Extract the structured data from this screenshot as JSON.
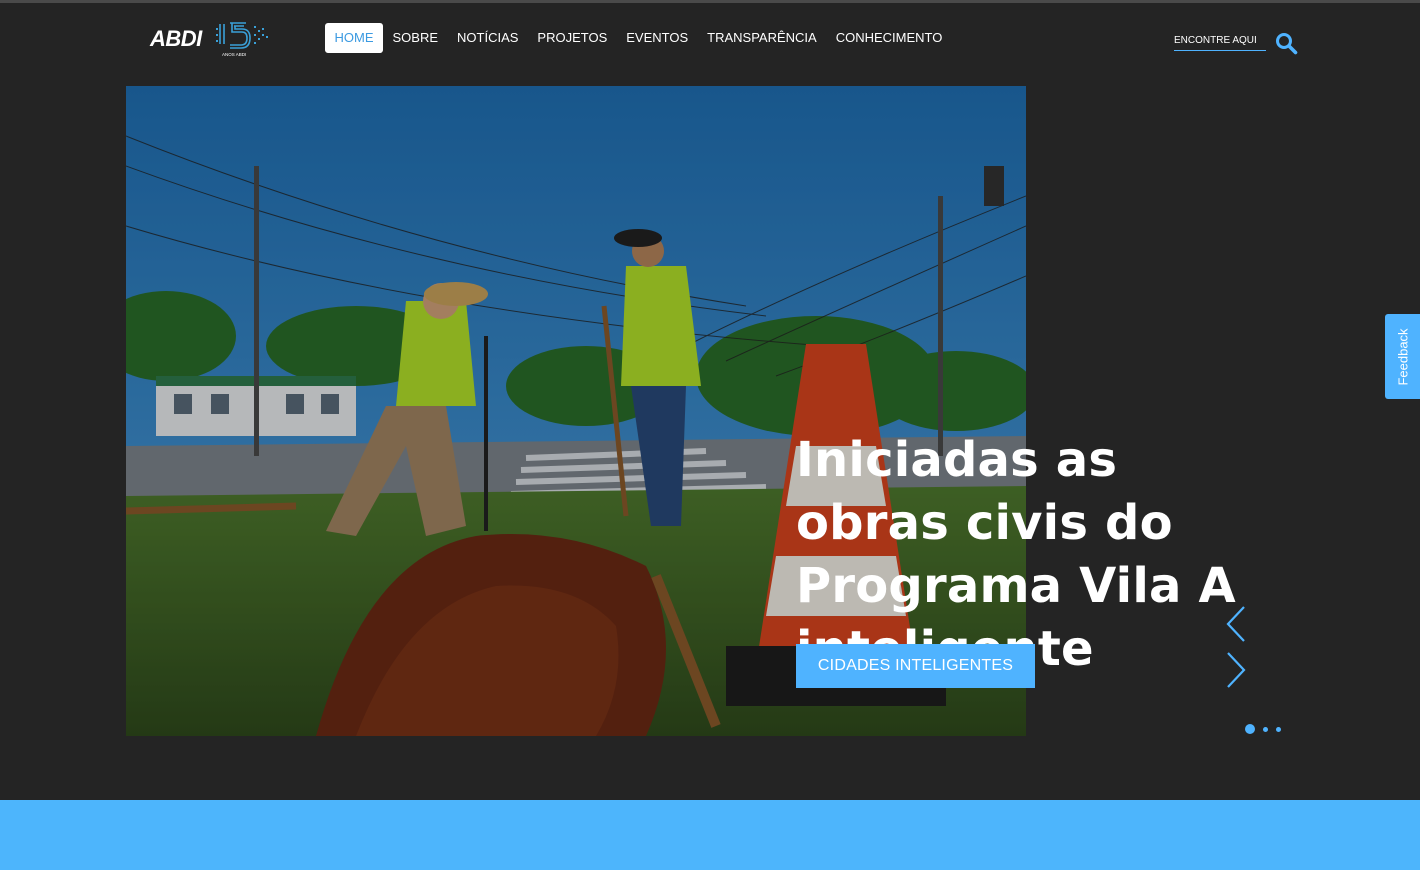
{
  "header": {
    "logo_text": "ABDI",
    "logo_badge": "15",
    "logo_badge_caption": "ANOS ABDI",
    "nav": [
      {
        "label": "HOME",
        "active": true
      },
      {
        "label": "SOBRE",
        "active": false
      },
      {
        "label": "NOTÍCIAS",
        "active": false
      },
      {
        "label": "PROJETOS",
        "active": false
      },
      {
        "label": "EVENTOS",
        "active": false
      },
      {
        "label": "TRANSPARÊNCIA",
        "active": false
      },
      {
        "label": "CONHECIMENTO",
        "active": false
      }
    ],
    "search": {
      "placeholder": "ENCONTRE AQUI",
      "icon": "search-icon"
    }
  },
  "hero": {
    "title": "Iniciadas as obras civis do Programa Vila A inteligente",
    "tag_button": "CIDADES INTELIGENTES",
    "prev_icon": "chevron-left-icon",
    "next_icon": "chevron-right-icon",
    "slides_count": 3,
    "active_slide": 1
  },
  "feedback": {
    "label": "Feedback"
  },
  "colors": {
    "background": "#242424",
    "accent": "#4fb3ff",
    "bottom_band": "#4db5fc",
    "nav_active_text": "#3b9ae1"
  }
}
